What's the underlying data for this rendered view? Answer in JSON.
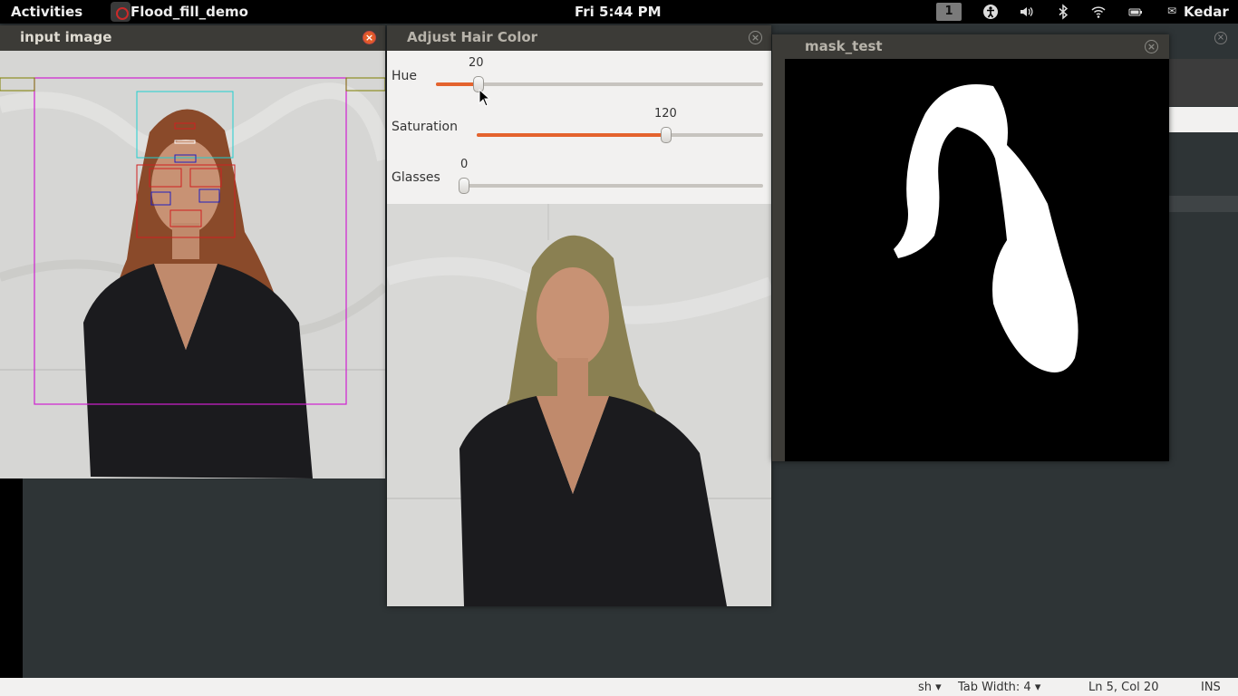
{
  "topbar": {
    "activities": "Activities",
    "app_name": "Flood_fill_demo",
    "clock": "Fri  5:44 PM",
    "workspace": "1",
    "user": "Kedar"
  },
  "windows": {
    "input": {
      "title": "input image",
      "close": "×"
    },
    "adjust": {
      "title": "Adjust Hair Color",
      "close": "×",
      "sliders": [
        {
          "label": "Hue",
          "value": "20",
          "fraction": 0.13
        },
        {
          "label": "Saturation",
          "value": "120",
          "fraction": 0.66
        },
        {
          "label": "Glasses",
          "value": "0",
          "fraction": 0.0
        }
      ]
    },
    "mask": {
      "title": "mask_test",
      "close": "×"
    }
  },
  "statusbar": {
    "language": "sh",
    "tab_width": "Tab Width: 4",
    "position": "Ln 5, Col 20",
    "mode": "INS"
  },
  "colors": {
    "accent": "#e4632e",
    "titlebar": "#3c3b37",
    "desktop": "#2e3436",
    "hair_original": "#8a4a2a",
    "hair_recolored": "#8a8052"
  }
}
